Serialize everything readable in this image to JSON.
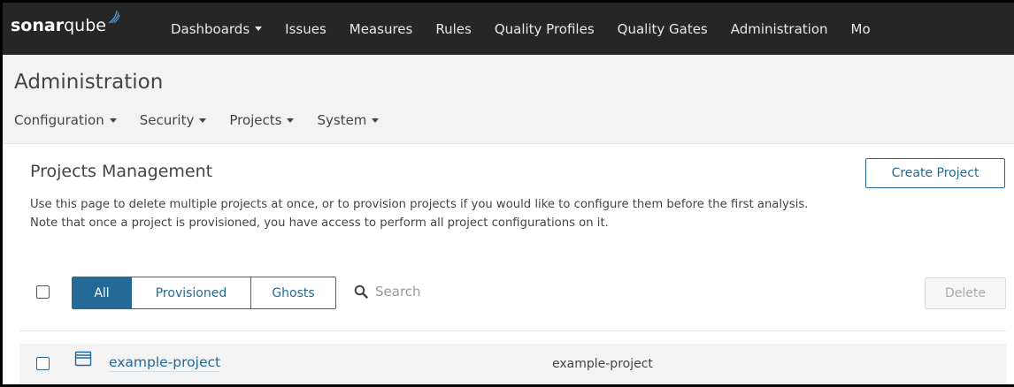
{
  "topnav": {
    "logo_bold": "sonar",
    "logo_light": "qube",
    "items": [
      {
        "label": "Dashboards",
        "dropdown": true
      },
      {
        "label": "Issues",
        "dropdown": false
      },
      {
        "label": "Measures",
        "dropdown": false
      },
      {
        "label": "Rules",
        "dropdown": false
      },
      {
        "label": "Quality Profiles",
        "dropdown": false
      },
      {
        "label": "Quality Gates",
        "dropdown": false
      },
      {
        "label": "Administration",
        "dropdown": false
      },
      {
        "label": "Mo",
        "dropdown": false
      }
    ]
  },
  "admin": {
    "title": "Administration",
    "tabs": [
      {
        "label": "Configuration"
      },
      {
        "label": "Security"
      },
      {
        "label": "Projects"
      },
      {
        "label": "System"
      }
    ]
  },
  "main": {
    "title": "Projects Management",
    "create_label": "Create Project",
    "desc_line1": "Use this page to delete multiple projects at once, or to provision projects if you would like to configure them before the first analysis.",
    "desc_line2": "Note that once a project is provisioned, you have access to perform all project configurations on it.",
    "filters": [
      {
        "label": "All",
        "active": true
      },
      {
        "label": "Provisioned",
        "active": false
      },
      {
        "label": "Ghosts",
        "active": false
      }
    ],
    "search_placeholder": "Search",
    "delete_label": "Delete",
    "projects": [
      {
        "name": "example-project",
        "key": "example-project"
      }
    ]
  },
  "colors": {
    "nav_bg": "#262626",
    "accent": "#236a97",
    "header_bg": "#f3f3f3"
  }
}
